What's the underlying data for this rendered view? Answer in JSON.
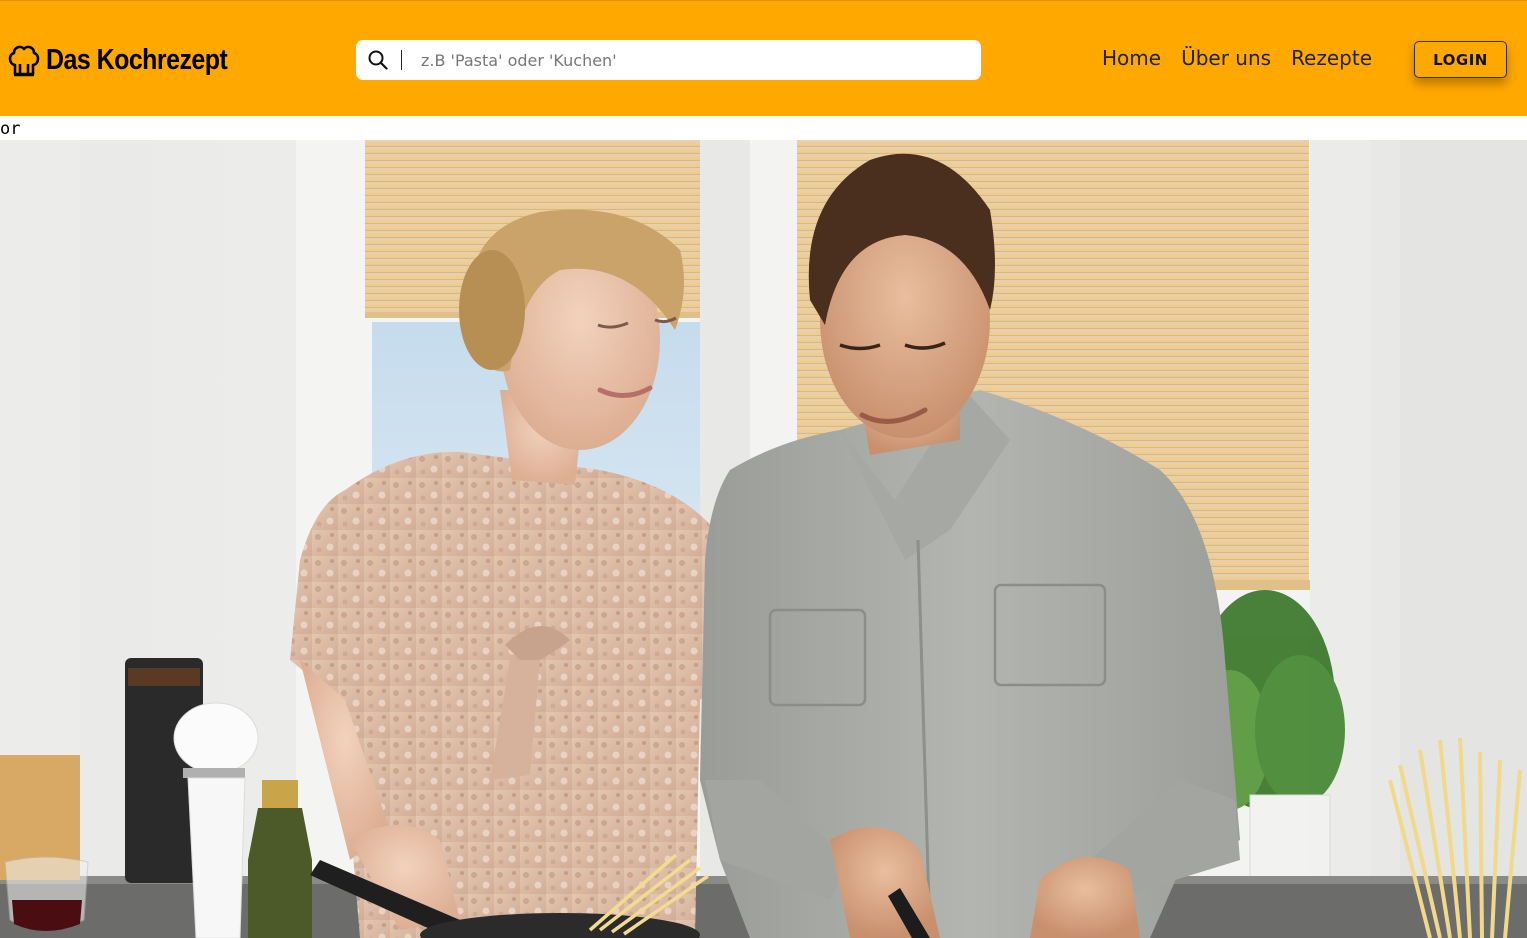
{
  "brand": {
    "name": "Das Kochrezept",
    "icon": "chef-hat-icon"
  },
  "search": {
    "placeholder": "z.B 'Pasta' oder 'Kuchen'",
    "value": "",
    "icon": "search-icon"
  },
  "nav": {
    "items": [
      {
        "label": "Home"
      },
      {
        "label": "Über uns"
      },
      {
        "label": "Rezepte"
      }
    ],
    "login_label": "LOGIN"
  },
  "stray_text": "or",
  "hero": {
    "alt": "couple cooking pasta in kitchen"
  },
  "colors": {
    "navbar": "#ffa800",
    "navbar_text": "#222222"
  }
}
